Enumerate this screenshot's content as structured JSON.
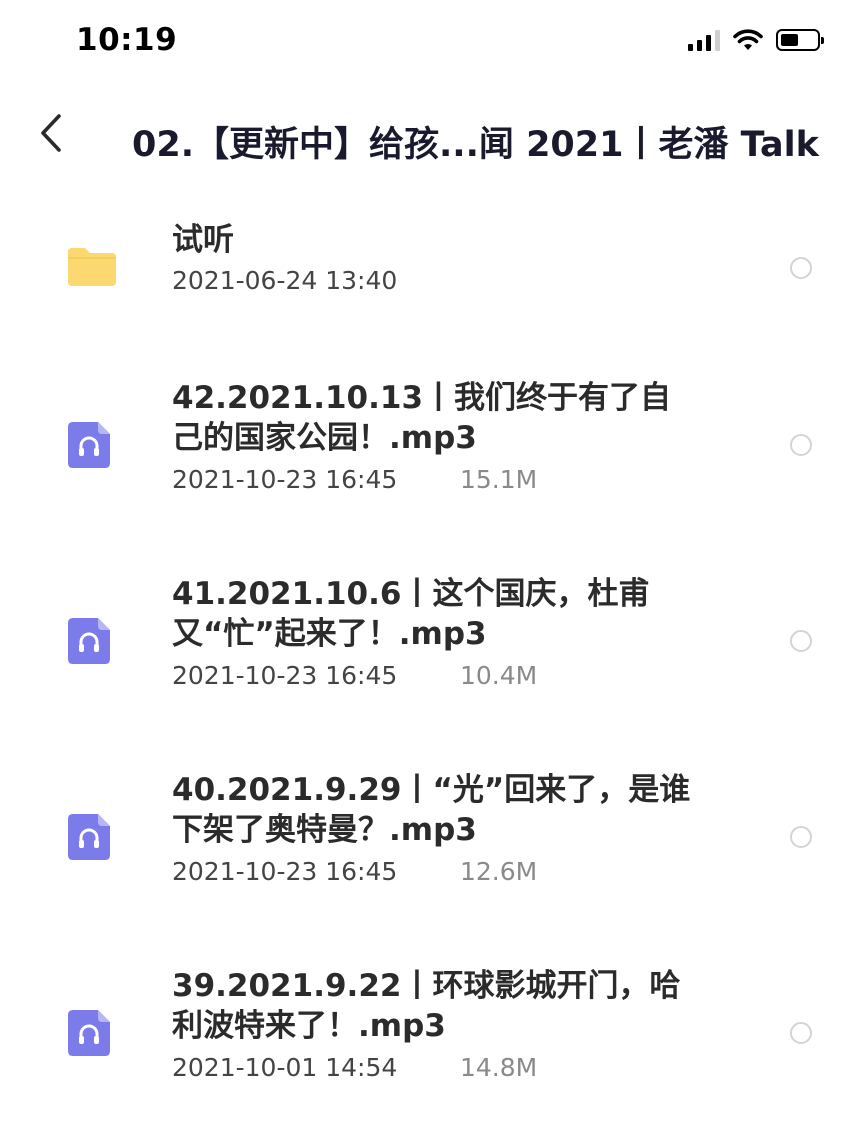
{
  "status_bar": {
    "time": "10:19",
    "icons": [
      "signal-icon",
      "wifi-icon",
      "battery-icon"
    ],
    "battery_level": 0.5
  },
  "header": {
    "back_icon": "chevron-left-icon",
    "title": "02.【更新中】给孩...闻 2021丨老潘 Talk"
  },
  "colors": {
    "folder": "#FBD970",
    "audio_icon": "#7C7BEA",
    "radio_border": "#D4D4D4"
  },
  "files": [
    {
      "type": "folder",
      "icon": "folder-icon",
      "name": "试听",
      "date": "2021-06-24 13:40",
      "size": ""
    },
    {
      "type": "audio",
      "icon": "headphones-file-icon",
      "name": "42.2021.10.13丨我们终于有了自己的国家公园！.mp3",
      "date": "2021-10-23 16:45",
      "size": "15.1M"
    },
    {
      "type": "audio",
      "icon": "headphones-file-icon",
      "name": "41.2021.10.6丨这个国庆，杜甫又“忙”起来了！.mp3",
      "date": "2021-10-23 16:45",
      "size": "10.4M"
    },
    {
      "type": "audio",
      "icon": "headphones-file-icon",
      "name": "40.2021.9.29丨“光”回来了，是谁下架了奥特曼？.mp3",
      "date": "2021-10-23 16:45",
      "size": "12.6M"
    },
    {
      "type": "audio",
      "icon": "headphones-file-icon",
      "name": "39.2021.9.22丨环球影城开门，哈利波特来了！.mp3",
      "date": "2021-10-01 14:54",
      "size": "14.8M"
    }
  ]
}
